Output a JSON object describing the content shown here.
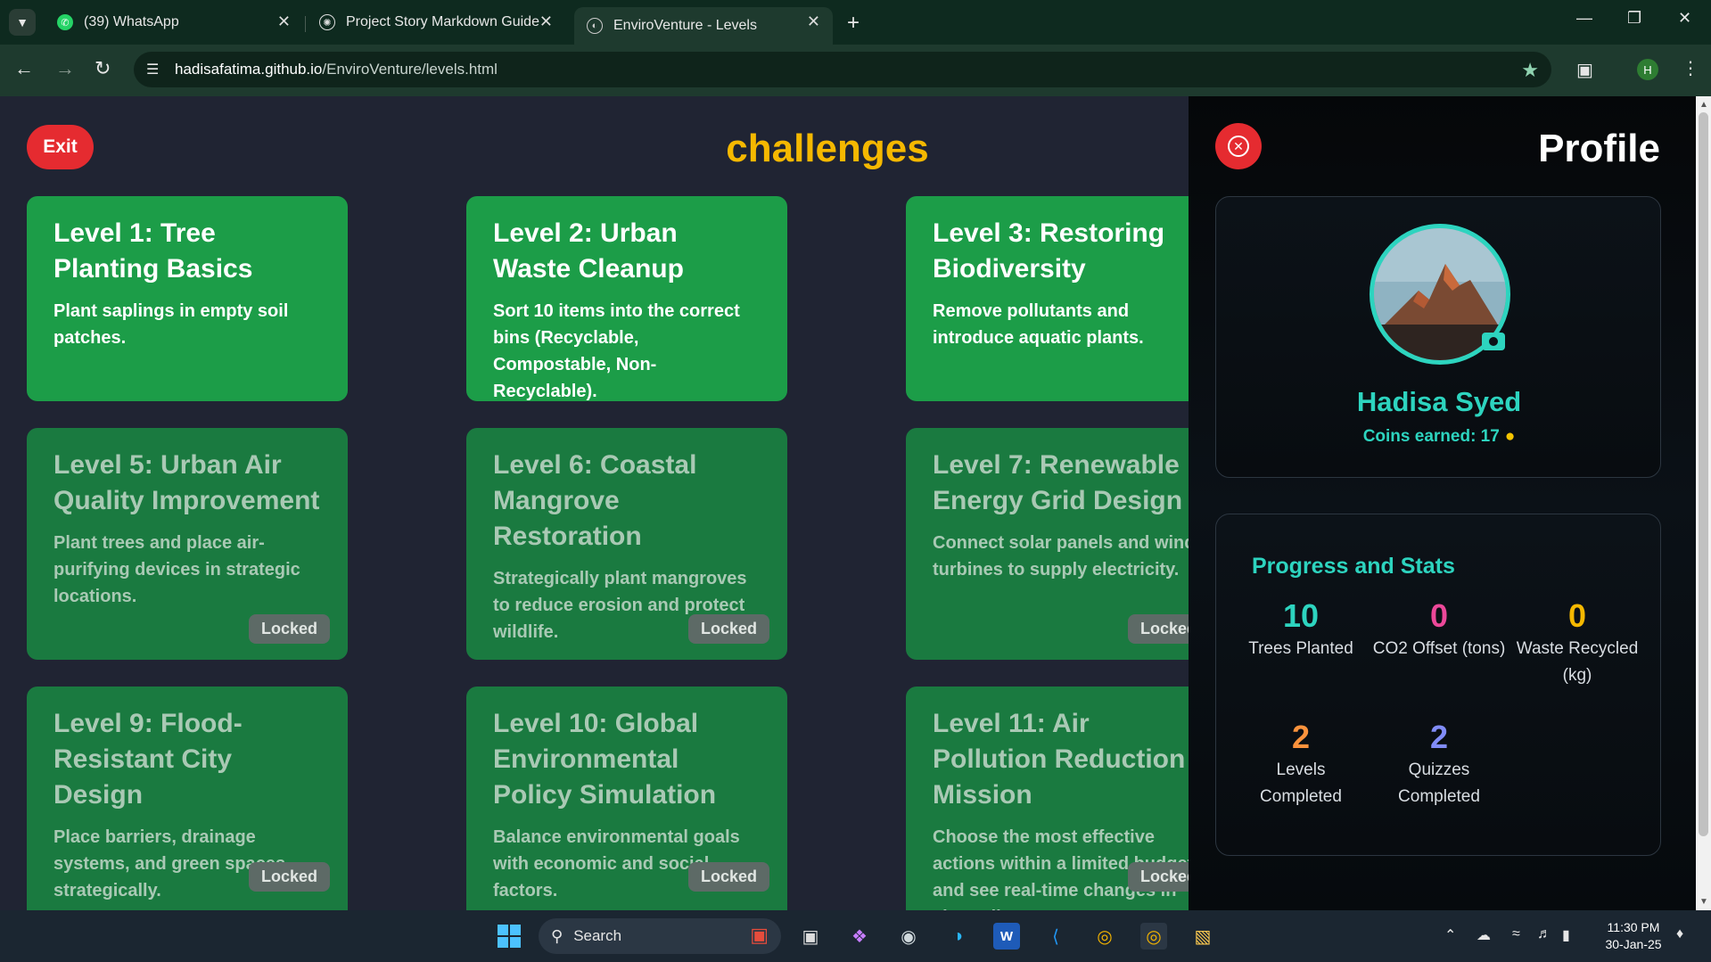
{
  "browser": {
    "tabs": [
      {
        "title": "(39) WhatsApp",
        "icon": "whatsapp-icon"
      },
      {
        "title": "Project Story Markdown Guide",
        "icon": "openai-icon"
      },
      {
        "title": "EnviroVenture - Levels",
        "icon": "globe-icon"
      }
    ],
    "url_host": "hadisafatima.github.io",
    "url_path": "/EnviroVenture/levels.html",
    "profile_initial": "H"
  },
  "page": {
    "exit_label": "Exit",
    "title": "challenges",
    "levels": [
      {
        "title": "Level 1: Tree Planting Basics",
        "desc": "Plant saplings in empty soil patches.",
        "locked": false
      },
      {
        "title": "Level 2: Urban Waste Cleanup",
        "desc": "Sort 10 items into the correct bins (Recyclable, Compostable, Non-Recyclable).",
        "locked": false
      },
      {
        "title": "Level 3: Restoring Biodiversity",
        "desc": "Remove pollutants and introduce aquatic plants.",
        "locked": false
      },
      {
        "title": "Level 5: Urban Air Quality Improvement",
        "desc": "Plant trees and place air-purifying devices in strategic locations.",
        "locked": true
      },
      {
        "title": "Level 6: Coastal Mangrove Restoration",
        "desc": "Strategically plant mangroves to reduce erosion and protect wildlife.",
        "locked": true
      },
      {
        "title": "Level 7: Renewable Energy Grid Design",
        "desc": "Connect solar panels and wind turbines to supply electricity.",
        "locked": true
      },
      {
        "title": "Level 9: Flood-Resistant City Design",
        "desc": "Place barriers, drainage systems, and green spaces strategically.",
        "locked": true
      },
      {
        "title": "Level 10: Global Environmental Policy Simulation",
        "desc": "Balance environmental goals with economic and social factors.",
        "locked": true
      },
      {
        "title": "Level 11: Air Pollution Reduction Mission",
        "desc": "Choose the most effective actions within a limited budget and see real-time changes in air quality.",
        "locked": true
      }
    ],
    "locked_label": "Locked"
  },
  "profile": {
    "title": "Profile",
    "name": "Hadisa Syed",
    "coins_text": "Coins earned: 17",
    "stats_title": "Progress and Stats",
    "stats": [
      {
        "value": "10",
        "label": "Trees Planted",
        "color": "#2dd4bf"
      },
      {
        "value": "0",
        "label": "CO2 Offset (tons)",
        "color": "#ec4899"
      },
      {
        "value": "0",
        "label": "Waste Recycled (kg)",
        "color": "#f5b800"
      },
      {
        "value": "2",
        "label": "Levels Completed",
        "color": "#fb923c"
      },
      {
        "value": "2",
        "label": "Quizzes Completed",
        "color": "#818cf8"
      }
    ]
  },
  "taskbar": {
    "search_label": "Search",
    "time": "11:30 PM",
    "date": "30-Jan-25"
  },
  "colors": {
    "card_active": "#1c9d48",
    "card_locked": "#1a7a40",
    "exit_red": "#e52b30",
    "title_gold": "#f5b800",
    "teal_accent": "#2dd4bf"
  }
}
